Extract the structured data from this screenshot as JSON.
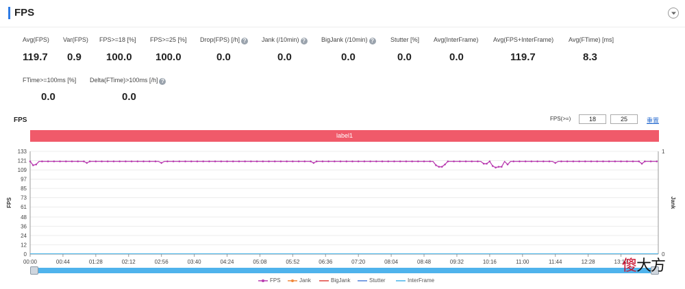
{
  "header": {
    "title": "FPS"
  },
  "metrics_row1": [
    {
      "label": "Avg(FPS)",
      "value": "119.7",
      "help": false
    },
    {
      "label": "Var(FPS)",
      "value": "0.9",
      "help": false
    },
    {
      "label": "FPS>=18 [%]",
      "value": "100.0",
      "help": false
    },
    {
      "label": "FPS>=25 [%]",
      "value": "100.0",
      "help": false
    },
    {
      "label": "Drop(FPS) [/h]",
      "value": "0.0",
      "help": true
    },
    {
      "label": "Jank (/10min)",
      "value": "0.0",
      "help": true
    },
    {
      "label": "BigJank (/10min)",
      "value": "0.0",
      "help": true
    },
    {
      "label": "Stutter [%]",
      "value": "0.0",
      "help": false
    },
    {
      "label": "Avg(InterFrame)",
      "value": "0.0",
      "help": false
    },
    {
      "label": "Avg(FPS+InterFrame)",
      "value": "119.7",
      "help": false
    },
    {
      "label": "Avg(FTime) [ms]",
      "value": "8.3",
      "help": false
    }
  ],
  "metrics_row2": [
    {
      "label": "FTime>=100ms [%]",
      "value": "0.0",
      "help": false
    },
    {
      "label": "Delta(FTime)>100ms [/h]",
      "value": "0.0",
      "help": true
    }
  ],
  "chart": {
    "title": "FPS",
    "filter_label": "FPS(>=)",
    "threshold_1": "18",
    "threshold_2": "25",
    "settings_link": "重置",
    "band_label": "label1"
  },
  "legend": [
    {
      "name": "FPS",
      "color": "#b83bb0",
      "marker": "circle"
    },
    {
      "name": "Jank",
      "color": "#f0883a",
      "marker": "circle"
    },
    {
      "name": "BigJank",
      "color": "#e0403a",
      "marker": "line"
    },
    {
      "name": "Stutter",
      "color": "#4e7fd8",
      "marker": "line"
    },
    {
      "name": "InterFrame",
      "color": "#45b3e8",
      "marker": "line"
    }
  ],
  "watermark": {
    "char1": "傻",
    "char2": "大方"
  },
  "chart_data": {
    "type": "line",
    "ylabel": "FPS",
    "y2label": "Jank",
    "ylim": [
      0,
      133
    ],
    "y_ticks": [
      0,
      12,
      24,
      36,
      48,
      61,
      73,
      85,
      97,
      109,
      121,
      133
    ],
    "y2lim": [
      0,
      1
    ],
    "y2_ticks": [
      0,
      1
    ],
    "x_ticks": [
      "00:00",
      "00:44",
      "01:28",
      "02:12",
      "02:56",
      "03:40",
      "04:24",
      "05:08",
      "05:52",
      "06:36",
      "07:20",
      "08:04",
      "08:48",
      "09:32",
      "10:16",
      "11:00",
      "11:44",
      "12:28",
      "13:12"
    ],
    "x_range_seconds": [
      0,
      842
    ],
    "grid": true,
    "legend_position": "bottom",
    "series": [
      {
        "name": "FPS",
        "baseline": 120,
        "dips": [
          [
            4,
            115
          ],
          [
            8,
            116
          ],
          [
            75,
            118
          ],
          [
            176,
            118
          ],
          [
            380,
            118
          ],
          [
            545,
            115
          ],
          [
            550,
            113
          ],
          [
            555,
            116
          ],
          [
            610,
            117
          ],
          [
            620,
            114
          ],
          [
            625,
            112
          ],
          [
            630,
            113
          ],
          [
            640,
            116
          ],
          [
            705,
            118
          ],
          [
            820,
            117
          ],
          [
            860,
            116
          ],
          [
            865,
            118
          ]
        ]
      },
      {
        "name": "Jank",
        "value": 0
      },
      {
        "name": "BigJank",
        "value": 0
      },
      {
        "name": "Stutter",
        "value": 0
      },
      {
        "name": "InterFrame",
        "value": 0
      }
    ]
  }
}
